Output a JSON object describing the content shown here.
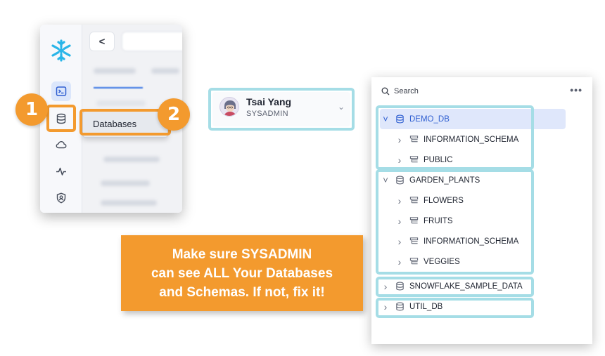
{
  "nav": {
    "items": [
      {
        "name": "worksheets-icon"
      },
      {
        "name": "database-icon"
      },
      {
        "name": "cloud-icon"
      },
      {
        "name": "activity-icon"
      },
      {
        "name": "admin-shield-icon"
      }
    ],
    "back_label": "<",
    "menu_item_label": "Databases"
  },
  "badges": {
    "one": "1",
    "two": "2"
  },
  "user": {
    "name": "Tsai Yang",
    "role": "SYSADMIN"
  },
  "tree": {
    "search_label": "Search",
    "more_label": "•••",
    "rows": [
      {
        "label": "DEMO_DB",
        "level": 0,
        "expanded": true,
        "type": "database",
        "selected": true
      },
      {
        "label": "INFORMATION_SCHEMA",
        "level": 1,
        "expanded": false,
        "type": "schema"
      },
      {
        "label": "PUBLIC",
        "level": 1,
        "expanded": false,
        "type": "schema"
      },
      {
        "label": "GARDEN_PLANTS",
        "level": 0,
        "expanded": true,
        "type": "database"
      },
      {
        "label": "FLOWERS",
        "level": 1,
        "expanded": false,
        "type": "schema"
      },
      {
        "label": "FRUITS",
        "level": 1,
        "expanded": false,
        "type": "schema"
      },
      {
        "label": "INFORMATION_SCHEMA",
        "level": 1,
        "expanded": false,
        "type": "schema"
      },
      {
        "label": "VEGGIES",
        "level": 1,
        "expanded": false,
        "type": "schema"
      },
      {
        "label": "SNOWFLAKE_SAMPLE_DATA",
        "level": 0,
        "expanded": false,
        "type": "database"
      },
      {
        "label": "UTIL_DB",
        "level": 0,
        "expanded": false,
        "type": "database"
      }
    ]
  },
  "callout": {
    "line1": "Make sure SYSADMIN",
    "line2": "can see ALL Your Databases",
    "line3": "and Schemas. If not, fix it!"
  },
  "colors": {
    "accent_orange": "#f39a2e",
    "highlight_teal": "#a5dde6",
    "selected_blue": "#2f5fd1"
  }
}
